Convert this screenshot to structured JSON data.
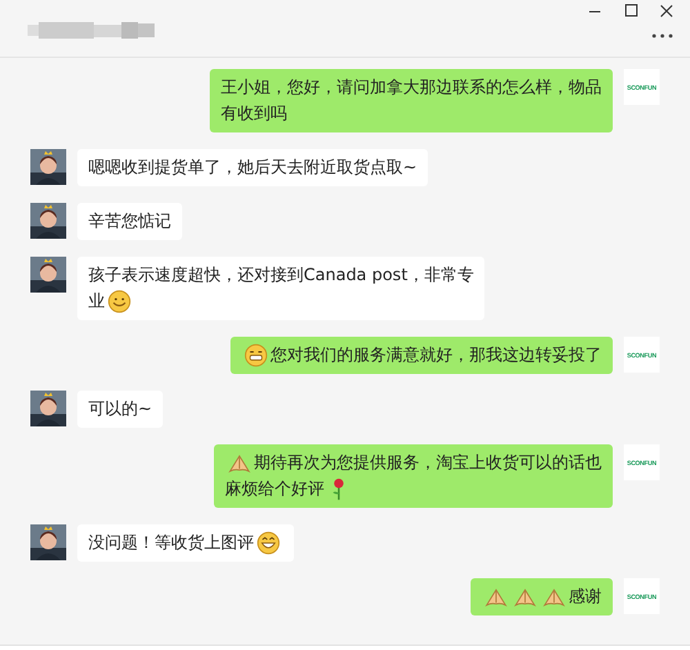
{
  "messages": [
    {
      "kind": "sent",
      "avatar_label": "SCONFUN",
      "lines": [
        [
          {
            "kind": "text",
            "text": "王小姐，您好，请问加拿大那边联系的怎么样，物品"
          }
        ],
        [
          {
            "kind": "text",
            "text": "有收到吗"
          }
        ]
      ]
    },
    {
      "kind": "received",
      "lines": [
        [
          {
            "kind": "text",
            "text": "嗯嗯收到提货单了，她后天去附近取货点取~"
          }
        ]
      ]
    },
    {
      "kind": "received",
      "lines": [
        [
          {
            "kind": "text",
            "text": "辛苦您惦记"
          }
        ]
      ]
    },
    {
      "kind": "received",
      "lines": [
        [
          {
            "kind": "text",
            "text": "孩子表示速度超快，还对接到Canada post，非常专"
          }
        ],
        [
          {
            "kind": "text",
            "text": "业"
          },
          {
            "kind": "smile"
          }
        ]
      ]
    },
    {
      "kind": "sent",
      "avatar_label": "SCONFUN",
      "lines": [
        [
          {
            "kind": "grimace"
          },
          {
            "kind": "text",
            "text": "您对我们的服务满意就好，那我这边转妥投了"
          }
        ]
      ]
    },
    {
      "kind": "received",
      "lines": [
        [
          {
            "kind": "text",
            "text": "可以的~"
          }
        ]
      ]
    },
    {
      "kind": "sent",
      "avatar_label": "SCONFUN",
      "lines": [
        [
          {
            "kind": "hands"
          },
          {
            "kind": "text",
            "text": "期待再次为您提供服务，淘宝上收货可以的话也"
          }
        ],
        [
          {
            "kind": "text",
            "text": "麻烦给个好评"
          },
          {
            "kind": "rose"
          }
        ]
      ]
    },
    {
      "kind": "received",
      "lines": [
        [
          {
            "kind": "text",
            "text": "没问题！等收货上图评"
          },
          {
            "kind": "grin"
          }
        ]
      ]
    },
    {
      "kind": "sent",
      "avatar_label": "SCONFUN",
      "lines": [
        [
          {
            "kind": "hands"
          },
          {
            "kind": "hands"
          },
          {
            "kind": "hands"
          },
          {
            "kind": "text",
            "text": "感谢"
          }
        ]
      ]
    }
  ]
}
